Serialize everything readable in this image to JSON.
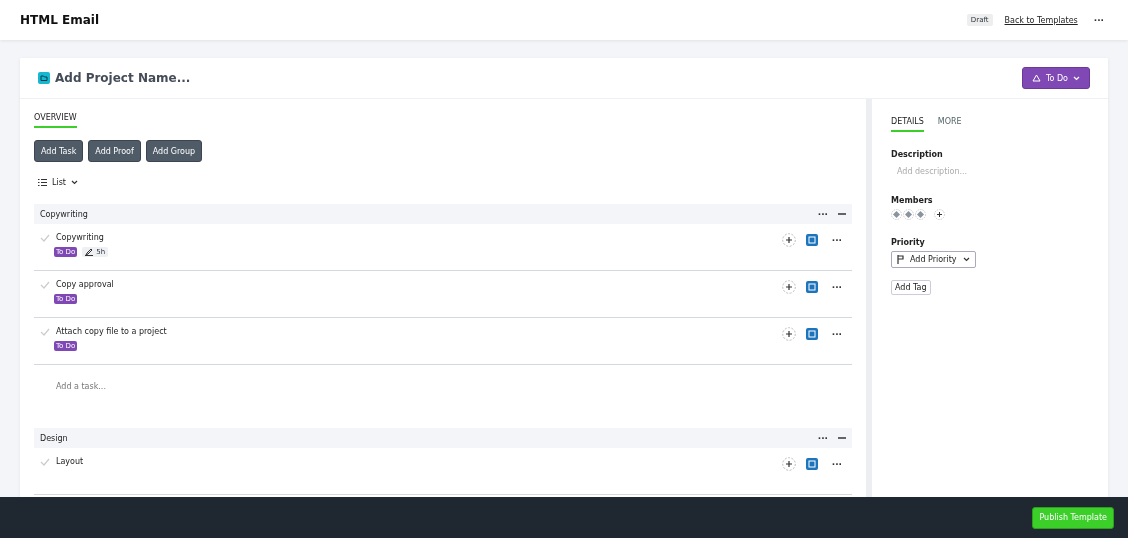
{
  "header": {
    "title": "HTML Email",
    "badge": "Draft",
    "link": "Back to Templates",
    "more": "···"
  },
  "project": {
    "name": "Add Project Name...",
    "status": "To Do"
  },
  "main_tabs": [
    {
      "label": "OVERVIEW",
      "selected": true
    }
  ],
  "actions": [
    "Add Task",
    "Add Proof",
    "Add Group"
  ],
  "view": {
    "label": "List"
  },
  "groups": [
    {
      "name": "Copywriting",
      "tasks": [
        {
          "name": "Copywriting",
          "status": "To Do",
          "estimate": "5h"
        },
        {
          "name": "Copy approval",
          "status": "To Do"
        },
        {
          "name": "Attach copy file to a project",
          "status": "To Do"
        }
      ],
      "add_placeholder": "Add a task..."
    },
    {
      "name": "Design",
      "tasks": [
        {
          "name": "Layout"
        }
      ]
    }
  ],
  "side_tabs": [
    {
      "label": "DETAILS",
      "selected": true
    },
    {
      "label": "MORE",
      "selected": false
    }
  ],
  "details": {
    "description_label": "Description",
    "description_placeholder": "Add description...",
    "members_label": "Members",
    "members": [
      {
        "kind": "avatar"
      },
      {
        "kind": "avatar"
      },
      {
        "kind": "avatar"
      }
    ],
    "priority_label": "Priority",
    "priority_button": "Add Priority",
    "tag_button": "Add Tag"
  },
  "footer": {
    "publish": "Publish Template"
  }
}
